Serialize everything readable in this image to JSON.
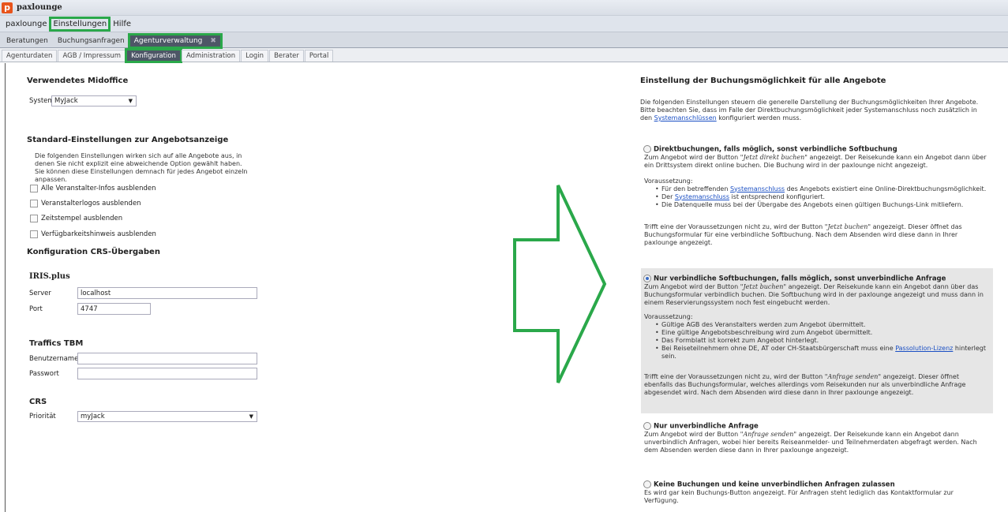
{
  "app": {
    "title": "paxlounge",
    "icon_letter": "p"
  },
  "menubar": {
    "items": [
      "paxlounge",
      "Einstellungen",
      "Hilfe"
    ]
  },
  "tabs_main": [
    "Beratungen",
    "Buchungsanfragen",
    "Agenturverwaltung"
  ],
  "tabs_sub": [
    "Agenturdaten",
    "AGB / Impressum",
    "Konfiguration",
    "Administration",
    "Login",
    "Berater",
    "Portal"
  ],
  "left": {
    "midoffice": {
      "heading": "Verwendetes Midoffice",
      "system_label": "System",
      "system_value": "MyJack"
    },
    "standard": {
      "heading": "Standard-Einstellungen zur Angebotsanzeige",
      "desc": "Die folgenden Einstellungen wirken sich auf alle Angebote aus, in denen Sie nicht explizit eine abweichende Option gewählt haben. Sie können diese Einstellungen demnach für jedes Angebot einzeln anpassen.",
      "checks": [
        "Alle Veranstalter-Infos ausblenden",
        "Veranstalterlogos ausblenden",
        "Zeitstempel ausblenden",
        "Verfügbarkeitshinweis ausblenden"
      ]
    },
    "crs": {
      "heading": "Konfiguration CRS-Übergaben",
      "iris": {
        "heading": "IRIS.plus",
        "server_label": "Server",
        "server_value": "localhost",
        "port_label": "Port",
        "port_value": "4747"
      },
      "traffics": {
        "heading": "Traffics TBM",
        "user_label": "Benutzername",
        "pass_label": "Passwort"
      },
      "crs_block": {
        "heading": "CRS",
        "prio_label": "Priorität",
        "prio_value": "myJack"
      }
    }
  },
  "right": {
    "heading": "Einstellung der Buchungsmöglichkeit für alle Angebote",
    "intro_1": "Die folgenden Einstellungen steuern die generelle Darstellung der Buchungsmöglichkeiten Ihrer Angebote. Bitte beachten Sie, dass im Falle der Direktbuchungsmöglichkeit jeder Systemanschluss noch zusätzlich in den",
    "intro_link": "Systemanschlüssen",
    "intro_2": "konfiguriert werden muss.",
    "options": {
      "o1": {
        "title": "Direktbuchungen, falls möglich, sonst verbindliche Softbuchung",
        "d1a": "Zum Angebot wird der Button ",
        "d1b": "\"Jetzt direkt buchen\"",
        "d1c": " angezeigt. Der Reisekunde kann ein Angebot dann über ein Drittsystem direkt online buchen. Die Buchung wird in der paxlounge nicht angezeigt.",
        "voraussetzung": "Voraussetzung:",
        "b1a": "Für den betreffenden ",
        "b1link": "Systemanschluss",
        "b1b": " des Angebots existiert eine Online-Direktbuchungsmöglichkeit.",
        "b2a": "Der ",
        "b2link": "Systemanschluss",
        "b2b": " ist entsprechend konfiguriert.",
        "b3": "Die Datenquelle muss bei der Übergabe des Angebots einen gültigen Buchungs-Link mitliefern.",
        "f1": "Trifft eine der Voraussetzungen nicht zu, wird der Button ",
        "f2": "\"Jetzt buchen\"",
        "f3": " angezeigt. Dieser öffnet das Buchungsformular für eine verbindliche Softbuchung. Nach dem Absenden wird diese dann in Ihrer paxlounge angezeigt."
      },
      "o2": {
        "title": "Nur verbindliche Softbuchungen, falls möglich, sonst unverbindliche Anfrage",
        "d1a": "Zum Angebot wird der Button ",
        "d1b": "\"Jetzt buchen\"",
        "d1c": " angezeigt. Der Reisekunde kann ein Angebot dann über das Buchungsformular verbindlich buchen. Die Softbuchung wird in der paxlounge angezeigt und muss dann in einem Reservierungssystem noch fest eingebucht werden.",
        "voraussetzung": "Voraussetzung:",
        "b1": "Gültige AGB des Veranstalters werden zum Angebot übermittelt.",
        "b2": "Eine gültige Angebotsbeschreibung wird zum Angebot übermittelt.",
        "b3": "Das Formblatt ist korrekt zum Angebot hinterlegt.",
        "b4a": "Bei Reiseteilnehmern ohne DE, AT oder CH-Staatsbürgerschaft muss eine ",
        "b4link": "Passolution-Lizenz",
        "b4b": " hinterlegt sein.",
        "f1": "Trifft eine der Voraussetzungen nicht zu, wird der Button ",
        "f2": "\"Anfrage senden\"",
        "f3": " angezeigt. Dieser öffnet ebenfalls das Buchungsformular, welches allerdings vom Reisekunden  nur als unverbindliche Anfrage abgesendet wird. Nach dem Absenden wird diese dann in Ihrer paxlounge angezeigt."
      },
      "o3": {
        "title": "Nur unverbindliche Anfrage",
        "d1a": "Zum Angebot wird der Button ",
        "d1b": "\"Anfrage senden\"",
        "d1c": " angezeigt. Der Reisekunde kann ein Angebot dann unverbindlich Anfragen, wobei hier bereits Reiseanmelder- und Teilnehmerdaten abgefragt werden. Nach dem Absenden werden diese dann in Ihrer paxlounge angezeigt."
      },
      "o4": {
        "title": "Keine Buchungen und keine unverbindlichen Anfragen zulassen",
        "desc": "Es wird gar kein Buchungs-Button angezeigt. Für Anfragen steht lediglich das Kontaktformular zur Verfügung."
      }
    }
  }
}
